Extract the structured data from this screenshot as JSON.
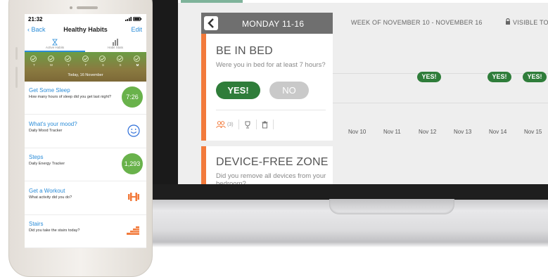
{
  "desktop": {
    "day_title": "MONDAY 11-16",
    "week_label": "WEEK OF NOVEMBER 10 - NOVEMBER 16",
    "visibility_label": "VISIBLE TO YO",
    "habits": [
      {
        "title": "BE IN BED",
        "question": "Were you in bed for at least 7 hours?",
        "yes_label": "YES!",
        "no_label": "NO",
        "people_count": "(3)"
      },
      {
        "title": "DEVICE-FREE ZONE",
        "question": "Did you remove all devices from your bedroom?"
      }
    ],
    "chart_dates": [
      "Nov 10",
      "Nov 11",
      "Nov 12",
      "Nov 13",
      "Nov 14",
      "Nov 15"
    ],
    "chart_yes_label": "YES!",
    "chart_yes_days": [
      "Nov 12",
      "Nov 14",
      "Nov 15"
    ]
  },
  "phone": {
    "status_time": "21:32",
    "nav_back": "Back",
    "nav_title": "Healthy Habits",
    "nav_edit": "Edit",
    "tabs": [
      "Active Habits",
      "Habit Stats"
    ],
    "week_days": [
      "T",
      "W",
      "T",
      "F",
      "S",
      "S",
      "M"
    ],
    "today_label": "Today, 16 November",
    "habits": [
      {
        "title": "Get Some Sleep",
        "subtitle": "How many hours of sleep did you get last night?",
        "value": "7:26"
      },
      {
        "title": "What's your mood?",
        "subtitle": "Daily Mood Tracker",
        "icon": "smiley-icon"
      },
      {
        "title": "Steps",
        "subtitle": "Daily Energy Tracker",
        "value": "1,293"
      },
      {
        "title": "Get a Workout",
        "subtitle": "What activity did you do?",
        "icon": "dumbbell-icon"
      },
      {
        "title": "Stairs",
        "subtitle": "Did you take the stairs today?",
        "icon": "stairs-icon"
      }
    ]
  },
  "colors": {
    "accent_orange": "#f27a3b",
    "yes_green": "#2f7d3a",
    "link_blue": "#2a8cd8",
    "value_green": "#69b24b"
  }
}
